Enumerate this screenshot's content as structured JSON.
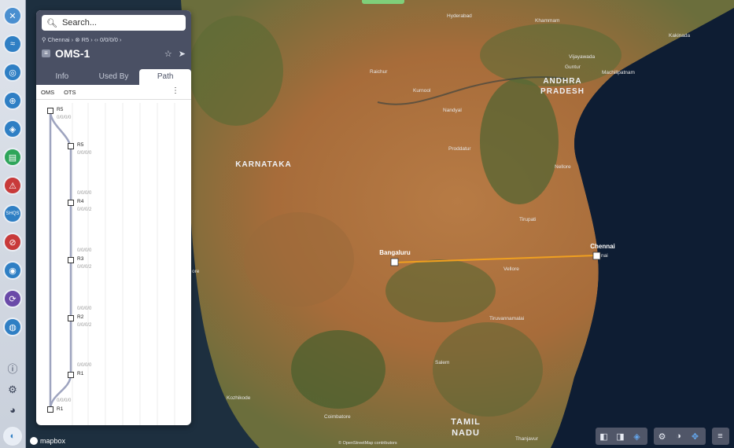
{
  "search": {
    "placeholder": "Search..."
  },
  "breadcrumb": {
    "location": "Chennai",
    "device": "R5",
    "port": "0/0/0/0"
  },
  "panel": {
    "title": "OMS-1"
  },
  "tabs": [
    {
      "label": "Info"
    },
    {
      "label": "Used By"
    },
    {
      "label": "Path"
    }
  ],
  "subtabs": [
    {
      "label": "OMS"
    },
    {
      "label": "OTS"
    }
  ],
  "path": {
    "nodes": [
      "R5",
      "R5",
      "R4",
      "R3",
      "R2",
      "R1",
      "R1"
    ],
    "ports": [
      "0/0/0/0",
      "0/0/0/0",
      "0/0/0/0",
      "0/0/0/2",
      "0/0/0/0",
      "0/0/0/2",
      "0/0/0/0",
      "0/0/0/2",
      "0/0/0/0",
      "0/0/0/0"
    ]
  },
  "map": {
    "regions": [
      "KARNATAKA",
      "ANDHRA PRADESH",
      "TAMIL NADU"
    ],
    "cities": [
      "Bangaluru",
      "Chennai"
    ],
    "places": [
      "Hyderabad",
      "Khammam",
      "Kakinada",
      "Vijayawada",
      "Machilipatnam",
      "Guntur",
      "Raichur",
      "Kurnool",
      "Nandyal",
      "Proddatur",
      "Nellore",
      "Tirupati",
      "Vellore",
      "Tiruvannamalai",
      "Salem",
      "Kozhikode",
      "Coimbatore",
      "Thanjavur",
      "ore",
      "nai"
    ],
    "attribution": "© OpenStreetMap contributors",
    "route_color": "#f0a020"
  },
  "brand": {
    "mapbox": "mapbox"
  },
  "controls": {
    "layers": [
      "layers",
      "layers",
      "layers"
    ],
    "view": [
      "settings",
      "contrast",
      "cursor"
    ],
    "menu": "menu"
  },
  "colors": {
    "accent": "#2f7fc4",
    "panel_header": "#4a5064"
  }
}
